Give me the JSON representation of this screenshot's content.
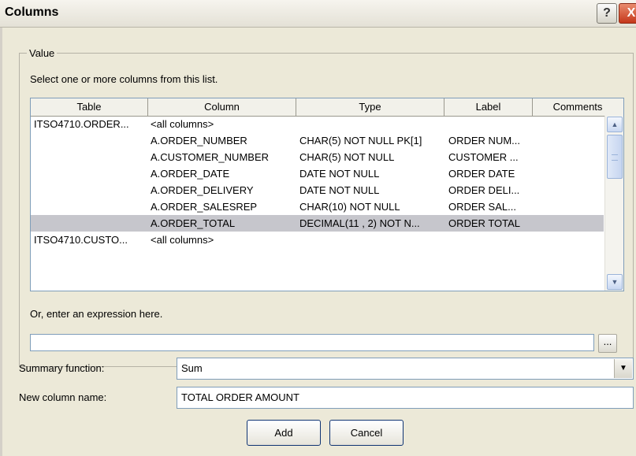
{
  "window": {
    "title": "Columns",
    "help_label": "?",
    "close_label": "X"
  },
  "value_group": {
    "label": "Value",
    "hint": "Select one or more columns from this list.",
    "headers": [
      "Table",
      "Column",
      "Type",
      "Label",
      "Comments"
    ],
    "rows": [
      {
        "table": "ITSO4710.ORDER...",
        "column": "<all columns>",
        "type": "",
        "label": "",
        "comments": ""
      },
      {
        "table": "",
        "column": "A.ORDER_NUMBER",
        "type": "CHAR(5) NOT NULL PK[1]",
        "label": "ORDER NUM...",
        "comments": ""
      },
      {
        "table": "",
        "column": "A.CUSTOMER_NUMBER",
        "type": "CHAR(5) NOT NULL",
        "label": "CUSTOMER ...",
        "comments": ""
      },
      {
        "table": "",
        "column": "A.ORDER_DATE",
        "type": "DATE NOT NULL",
        "label": "ORDER DATE",
        "comments": ""
      },
      {
        "table": "",
        "column": "A.ORDER_DELIVERY",
        "type": "DATE NOT NULL",
        "label": "ORDER DELI...",
        "comments": ""
      },
      {
        "table": "",
        "column": "A.ORDER_SALESREP",
        "type": "CHAR(10) NOT NULL",
        "label": "ORDER SAL...",
        "comments": ""
      },
      {
        "table": "",
        "column": "A.ORDER_TOTAL",
        "type": "DECIMAL(11 , 2) NOT N...",
        "label": "ORDER TOTAL",
        "comments": "",
        "selected": true
      },
      {
        "table": "ITSO4710.CUSTO...",
        "column": "<all columns>",
        "type": "",
        "label": "",
        "comments": ""
      }
    ],
    "expression_label": "Or, enter an expression here.",
    "expression_value": "",
    "ellipsis_label": "..."
  },
  "summary_function": {
    "label": "Summary function:",
    "value": "Sum"
  },
  "new_column_name": {
    "label": "New column name:",
    "value": "TOTAL ORDER AMOUNT"
  },
  "buttons": {
    "add": "Add",
    "cancel": "Cancel"
  },
  "icons": {
    "scroll_up": "chevron-up-icon",
    "scroll_down": "chevron-down-icon",
    "dropdown": "dropdown-arrow-icon"
  }
}
